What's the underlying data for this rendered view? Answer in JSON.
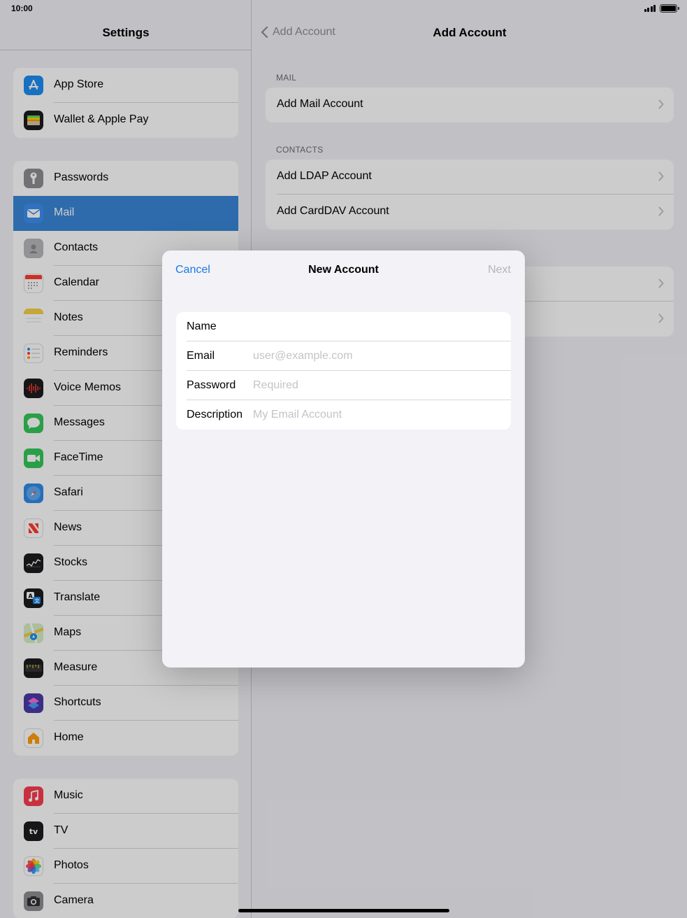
{
  "status": {
    "time": "10:00"
  },
  "sidebar": {
    "title": "Settings",
    "groups": [
      {
        "items": [
          {
            "label": "App Store",
            "icon": "app-store-icon",
            "color": "#1e8cf0"
          },
          {
            "label": "Wallet & Apple Pay",
            "icon": "wallet-icon",
            "color": "#1c1c1e"
          }
        ]
      },
      {
        "items": [
          {
            "label": "Passwords",
            "icon": "key-icon",
            "color": "#8e8e93"
          },
          {
            "label": "Mail",
            "icon": "mail-icon",
            "color": "#3d8ef0",
            "selected": true
          },
          {
            "label": "Contacts",
            "icon": "contacts-icon",
            "color": "#b8b8bc"
          },
          {
            "label": "Calendar",
            "icon": "calendar-icon",
            "color": "#ffffff"
          },
          {
            "label": "Notes",
            "icon": "notes-icon",
            "color": "#f7d046"
          },
          {
            "label": "Reminders",
            "icon": "reminders-icon",
            "color": "#ffffff"
          },
          {
            "label": "Voice Memos",
            "icon": "voice-memos-icon",
            "color": "#1c1c1e"
          },
          {
            "label": "Messages",
            "icon": "messages-icon",
            "color": "#34c759"
          },
          {
            "label": "FaceTime",
            "icon": "facetime-icon",
            "color": "#34c759"
          },
          {
            "label": "Safari",
            "icon": "safari-icon",
            "color": "#2f8be8"
          },
          {
            "label": "News",
            "icon": "news-icon",
            "color": "#ffffff"
          },
          {
            "label": "Stocks",
            "icon": "stocks-icon",
            "color": "#1c1c1e"
          },
          {
            "label": "Translate",
            "icon": "translate-icon",
            "color": "#1c1c1e"
          },
          {
            "label": "Maps",
            "icon": "maps-icon",
            "color": "#7fc96b"
          },
          {
            "label": "Measure",
            "icon": "measure-icon",
            "color": "#1c1c1e"
          },
          {
            "label": "Shortcuts",
            "icon": "shortcuts-icon",
            "color": "#4a3aa8"
          },
          {
            "label": "Home",
            "icon": "home-icon",
            "color": "#ffffff"
          }
        ]
      },
      {
        "items": [
          {
            "label": "Music",
            "icon": "music-icon",
            "color": "#fa3c4f"
          },
          {
            "label": "TV",
            "icon": "tv-icon",
            "color": "#1c1c1e"
          },
          {
            "label": "Photos",
            "icon": "photos-icon",
            "color": "#ffffff"
          },
          {
            "label": "Camera",
            "icon": "camera-icon",
            "color": "#8e8e93"
          }
        ]
      }
    ]
  },
  "detail": {
    "back_label": "Add Account",
    "title": "Add Account",
    "sections": [
      {
        "header": "MAIL",
        "rows": [
          "Add Mail Account"
        ]
      },
      {
        "header": "CONTACTS",
        "rows": [
          "Add LDAP Account",
          "Add CardDAV Account"
        ]
      },
      {
        "header": "",
        "rows": [
          "",
          ""
        ]
      }
    ]
  },
  "modal": {
    "cancel": "Cancel",
    "title": "New Account",
    "next": "Next",
    "fields": [
      {
        "label": "Name",
        "value": "",
        "placeholder": ""
      },
      {
        "label": "Email",
        "value": "",
        "placeholder": "user@example.com"
      },
      {
        "label": "Password",
        "value": "",
        "placeholder": "Required"
      },
      {
        "label": "Description",
        "value": "",
        "placeholder": "My Email Account"
      }
    ]
  }
}
